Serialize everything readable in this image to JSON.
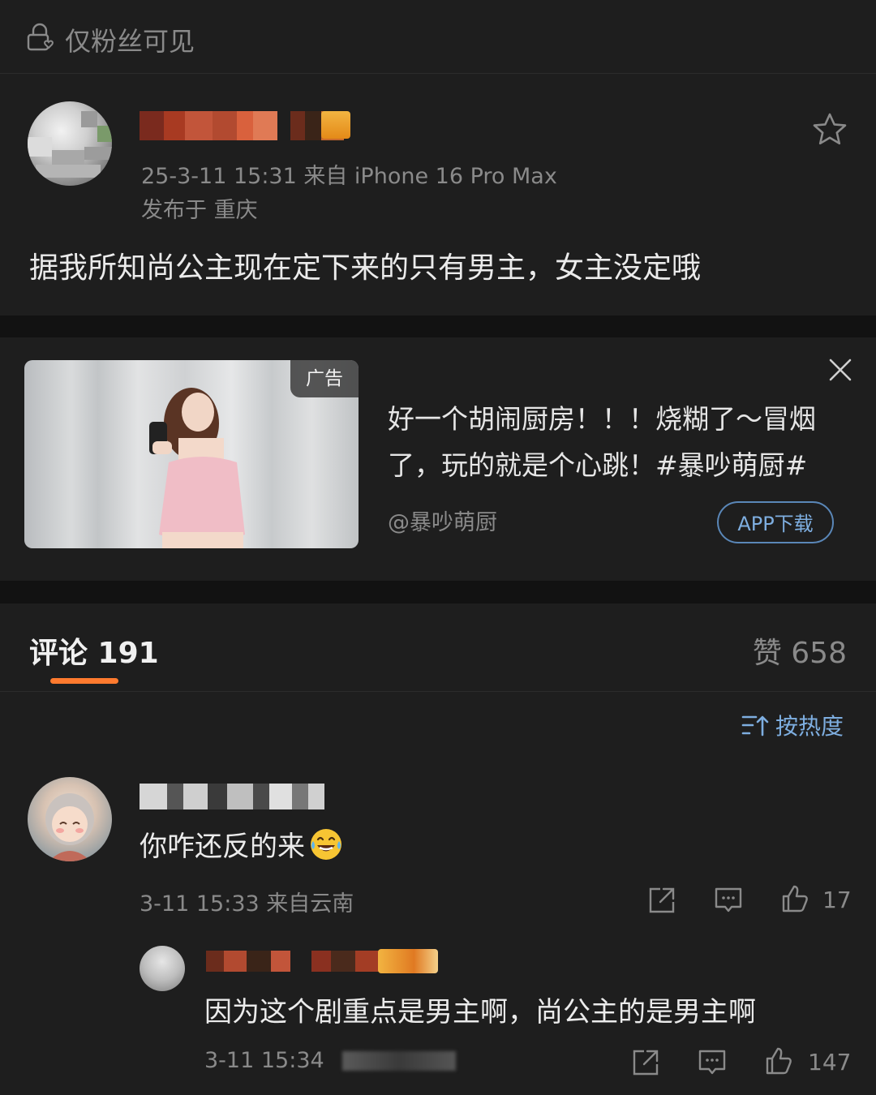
{
  "topbar": {
    "visibility_text": "仅粉丝可见",
    "icon": "lock-heart-icon"
  },
  "post": {
    "meta": "25-3-11 15:31  来自 iPhone 16 Pro Max",
    "location": "发布于 重庆",
    "text": "据我所知尚公主现在定下来的只有男主，女主没定哦",
    "favorite_icon": "star-icon"
  },
  "ad": {
    "tag": "广告",
    "title": "好一个胡闹厨房！！！烧糊了～冒烟了，玩的就是个心跳！#暴吵萌厨#",
    "author": "@暴吵萌厨",
    "button": "APP下载",
    "close_icon": "close-icon"
  },
  "comments_header": {
    "tab_label": "评论 191",
    "likes_label": "赞 658",
    "accent": "#ff7a2e"
  },
  "sort": {
    "label": "按热度",
    "icon": "sort-icon"
  },
  "comments": [
    {
      "text": "你咋还反的来",
      "emoji": "laughing-tears-emoji",
      "meta": "3-11 15:33  来自云南",
      "like_count": "17"
    },
    {
      "text": "因为这个剧重点是男主啊，尚公主的是男主啊",
      "meta": "3-11 15:34",
      "like_count": "147"
    }
  ],
  "colors": {
    "background": "#1e1e1e",
    "link_blue": "#7eaee0",
    "muted": "#8a8a8a"
  }
}
